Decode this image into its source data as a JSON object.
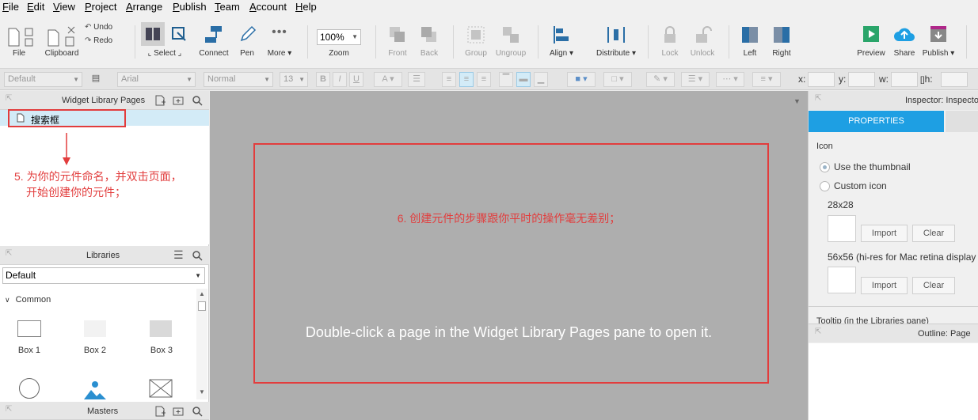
{
  "menu": [
    {
      "label": "File"
    },
    {
      "label": "Edit"
    },
    {
      "label": "View"
    },
    {
      "label": "Project"
    },
    {
      "label": "Arrange"
    },
    {
      "label": "Publish"
    },
    {
      "label": "Team"
    },
    {
      "label": "Account"
    },
    {
      "label": "Help"
    }
  ],
  "toolbar": {
    "file": "File",
    "clipboard": "Clipboard",
    "undo": "Undo",
    "redo": "Redo",
    "select": "Select",
    "connect": "Connect",
    "pen": "Pen",
    "more": "More ▾",
    "zoom_value": "100%",
    "zoom": "Zoom",
    "front": "Front",
    "back": "Back",
    "group": "Group",
    "ungroup": "Ungroup",
    "align": "Align ▾",
    "distribute": "Distribute ▾",
    "lock": "Lock",
    "unlock": "Unlock",
    "left": "Left",
    "right": "Right",
    "preview": "Preview",
    "share": "Share",
    "publish": "Publish ▾"
  },
  "formatbar": {
    "style": "Default",
    "font": "Arial",
    "weight": "Normal",
    "size": "13",
    "bold": "B",
    "italic": "I",
    "underline": "U",
    "x_label": "x:",
    "y_label": "y:",
    "w_label": "w:",
    "h_label": "h:"
  },
  "widget_pages": {
    "title": "Widget Library Pages",
    "page_name": "搜索框",
    "annotation_line1": "5. 为你的元件命名，并双击页面，",
    "annotation_line2": "开始创建你的元件；"
  },
  "libraries": {
    "title": "Libraries",
    "selected": "Default",
    "group": "Common",
    "items": [
      {
        "label": "Box 1"
      },
      {
        "label": "Box 2"
      },
      {
        "label": "Box 3"
      }
    ]
  },
  "masters": {
    "title": "Masters"
  },
  "canvas": {
    "annotation": "6. 创建元件的步骤跟你平时的操作毫无差别；",
    "message": "Double-click a page in the Widget Library Pages pane to open it."
  },
  "inspector": {
    "title": "Inspector: Inspecto",
    "tab_properties": "PROPERTIES",
    "icon_label": "Icon",
    "use_thumbnail": "Use the thumbnail",
    "custom_icon": "Custom icon",
    "size_small": "28x28",
    "import": "Import",
    "clear": "Clear",
    "size_large": "56x56 (hi-res for Mac retina display",
    "tooltip": "Tooltip (in the Libraries pane)"
  },
  "outline": {
    "title": "Outline: Page"
  },
  "colors": {
    "accent": "#1e9fe3",
    "annotation_red": "#e23d3d",
    "canvas_bg": "#aeaeae",
    "selected_row": "#d3ebf7"
  }
}
